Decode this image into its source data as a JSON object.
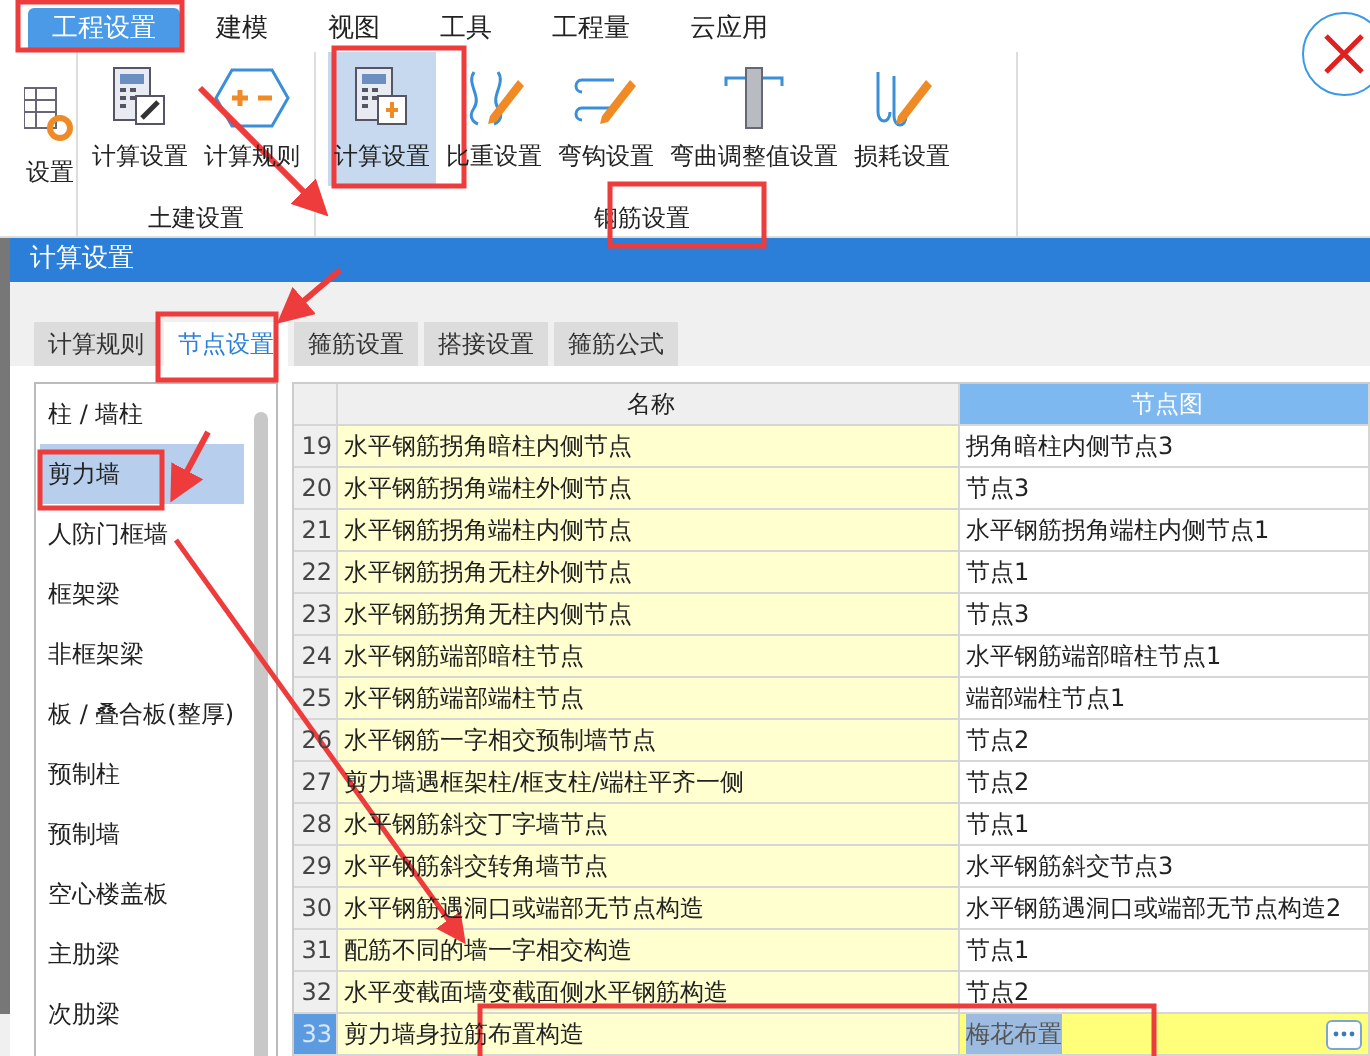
{
  "menu": [
    {
      "label": "工程设置",
      "selected": true
    },
    {
      "label": "建模",
      "selected": false
    },
    {
      "label": "视图",
      "selected": false
    },
    {
      "label": "工具",
      "selected": false
    },
    {
      "label": "工程量",
      "selected": false
    },
    {
      "label": "云应用",
      "selected": false
    }
  ],
  "ribbon": {
    "leading_button": {
      "label": "设置",
      "kind": "table-gear"
    },
    "groups": [
      {
        "label": "土建设置",
        "buttons": [
          {
            "label": "计算设置",
            "kind": "calc-wrench",
            "selected": false
          },
          {
            "label": "计算规则",
            "kind": "plus-minus",
            "selected": false
          }
        ]
      },
      {
        "label": "钢筋设置",
        "buttons": [
          {
            "label": "计算设置",
            "kind": "calc-plus",
            "selected": true
          },
          {
            "label": "比重设置",
            "kind": "bracket-pencil",
            "selected": false
          },
          {
            "label": "弯钩设置",
            "kind": "hook-pencil",
            "selected": false
          },
          {
            "label": "弯曲调整值设置",
            "kind": "column",
            "selected": false
          },
          {
            "label": "损耗设置",
            "kind": "hooks-pencil",
            "selected": false
          }
        ]
      }
    ]
  },
  "dialog": {
    "title": "计算设置",
    "tabs": [
      {
        "label": "计算规则",
        "selected": false
      },
      {
        "label": "节点设置",
        "selected": true
      },
      {
        "label": "箍筋设置",
        "selected": false
      },
      {
        "label": "搭接设置",
        "selected": false
      },
      {
        "label": "箍筋公式",
        "selected": false
      }
    ],
    "categories": [
      {
        "label": "柱 / 墙柱",
        "selected": false
      },
      {
        "label": "剪力墙",
        "selected": true
      },
      {
        "label": "人防门框墙",
        "selected": false
      },
      {
        "label": "框架梁",
        "selected": false
      },
      {
        "label": "非框架梁",
        "selected": false
      },
      {
        "label": "板 / 叠合板(整厚)",
        "selected": false
      },
      {
        "label": "预制柱",
        "selected": false
      },
      {
        "label": "预制墙",
        "selected": false
      },
      {
        "label": "空心楼盖板",
        "selected": false
      },
      {
        "label": "主肋梁",
        "selected": false
      },
      {
        "label": "次肋梁",
        "selected": false
      }
    ],
    "table": {
      "columns": [
        {
          "label": "名称",
          "selected": false
        },
        {
          "label": "节点图",
          "selected": true
        }
      ],
      "rows": [
        {
          "number": "19",
          "name": "水平钢筋拐角暗柱内侧节点",
          "node": "拐角暗柱内侧节点3",
          "selected": false
        },
        {
          "number": "20",
          "name": "水平钢筋拐角端柱外侧节点",
          "node": "节点3",
          "selected": false
        },
        {
          "number": "21",
          "name": "水平钢筋拐角端柱内侧节点",
          "node": "水平钢筋拐角端柱内侧节点1",
          "selected": false
        },
        {
          "number": "22",
          "name": "水平钢筋拐角无柱外侧节点",
          "node": "节点1",
          "selected": false
        },
        {
          "number": "23",
          "name": "水平钢筋拐角无柱内侧节点",
          "node": "节点3",
          "selected": false
        },
        {
          "number": "24",
          "name": "水平钢筋端部暗柱节点",
          "node": "水平钢筋端部暗柱节点1",
          "selected": false
        },
        {
          "number": "25",
          "name": "水平钢筋端部端柱节点",
          "node": "端部端柱节点1",
          "selected": false
        },
        {
          "number": "26",
          "name": "水平钢筋一字相交预制墙节点",
          "node": "节点2",
          "selected": false
        },
        {
          "number": "27",
          "name": "剪力墙遇框架柱/框支柱/端柱平齐一侧",
          "node": "节点2",
          "selected": false
        },
        {
          "number": "28",
          "name": "水平钢筋斜交丁字墙节点",
          "node": "节点1",
          "selected": false
        },
        {
          "number": "29",
          "name": "水平钢筋斜交转角墙节点",
          "node": "水平钢筋斜交节点3",
          "selected": false
        },
        {
          "number": "30",
          "name": "水平钢筋遇洞口或端部无节点构造",
          "node": "水平钢筋遇洞口或端部无节点构造2",
          "selected": false
        },
        {
          "number": "31",
          "name": "配筋不同的墙一字相交构造",
          "node": "节点1",
          "selected": false
        },
        {
          "number": "32",
          "name": "水平变截面墙变截面侧水平钢筋构造",
          "node": "节点2",
          "selected": false
        },
        {
          "number": "33",
          "name": "剪力墙身拉筋布置构造",
          "node": "梅花布置",
          "selected": true
        }
      ]
    }
  }
}
